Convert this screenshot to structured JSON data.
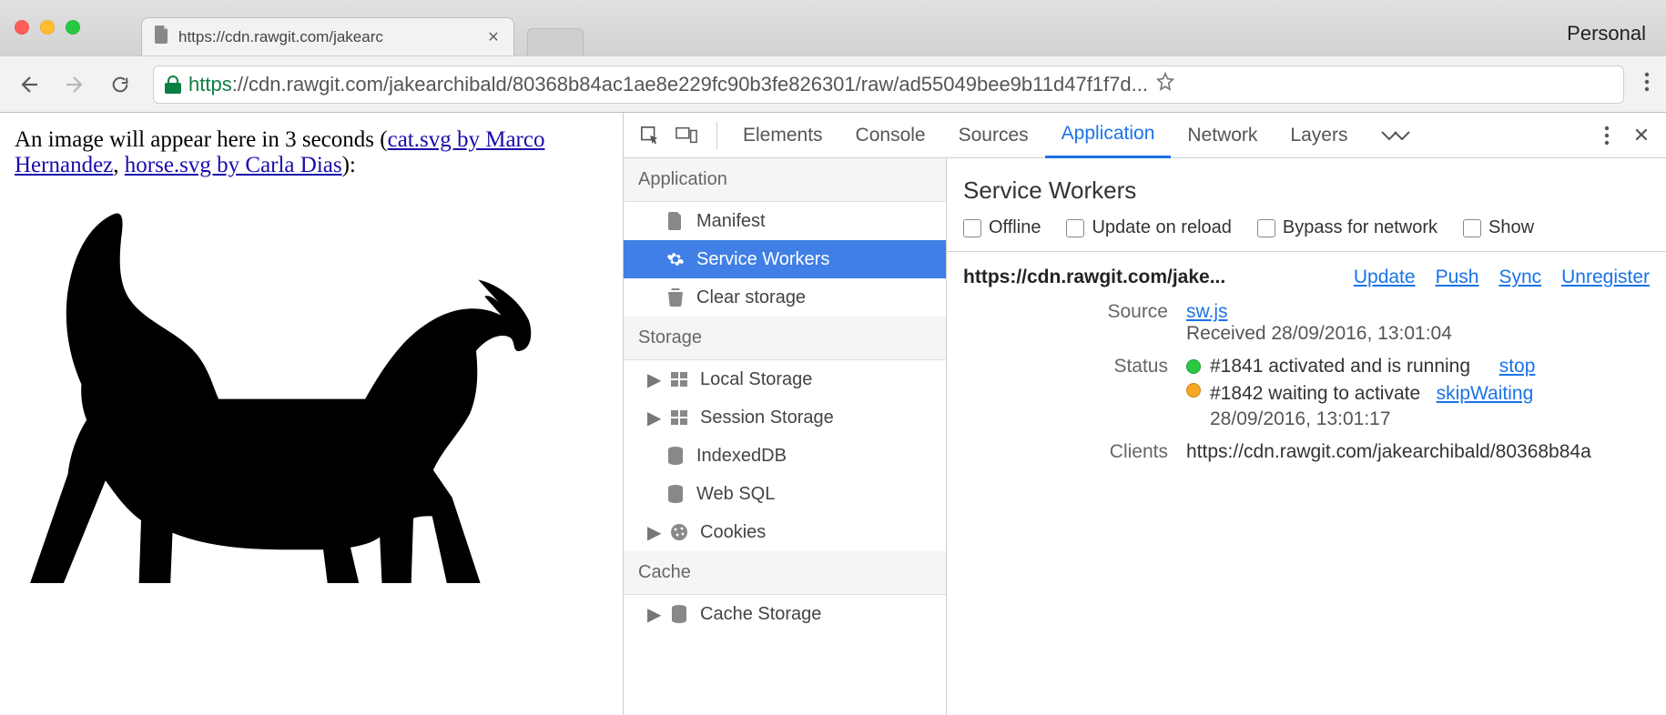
{
  "browser": {
    "personal_label": "Personal",
    "tab_title": "https://cdn.rawgit.com/jakearc",
    "url_scheme": "https",
    "url_rest": "://cdn.rawgit.com/jakearchibald/80368b84ac1ae8e229fc90b3fe826301/raw/ad55049bee9b11d47f1f7d..."
  },
  "page": {
    "intro_before": "An image will appear here in 3 seconds (",
    "link1": "cat.svg by Marco Hernandez",
    "sep": ", ",
    "link2": "horse.svg by Carla Dias",
    "intro_after": "):"
  },
  "devtools": {
    "tabs": [
      "Elements",
      "Console",
      "Sources",
      "Application",
      "Network",
      "Layers"
    ],
    "active_tab": "Application",
    "side": {
      "group_app": "Application",
      "app_items": [
        "Manifest",
        "Service Workers",
        "Clear storage"
      ],
      "group_storage": "Storage",
      "storage_items": [
        "Local Storage",
        "Session Storage",
        "IndexedDB",
        "Web SQL",
        "Cookies"
      ],
      "group_cache": "Cache",
      "cache_items": [
        "Cache Storage"
      ]
    },
    "sw": {
      "title": "Service Workers",
      "opts": [
        "Offline",
        "Update on reload",
        "Bypass for network",
        "Show"
      ],
      "scope": "https://cdn.rawgit.com/jake...",
      "actions": [
        "Update",
        "Push",
        "Sync",
        "Unregister"
      ],
      "labels": {
        "source": "Source",
        "status": "Status",
        "clients": "Clients"
      },
      "source_link": "sw.js",
      "source_received": "Received 28/09/2016, 13:01:04",
      "status_active": "#1841 activated and is running",
      "stop_label": "stop",
      "status_waiting": "#1842 waiting to activate",
      "skip_label": "skipWaiting",
      "waiting_time": "28/09/2016, 13:01:17",
      "clients_val": "https://cdn.rawgit.com/jakearchibald/80368b84a"
    }
  }
}
